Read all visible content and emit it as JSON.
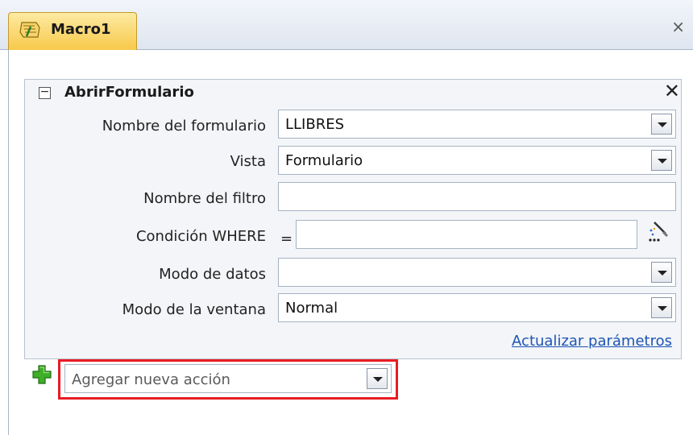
{
  "window": {
    "tab_title": "Macro1",
    "close_glyph": "×"
  },
  "action": {
    "name": "AbrirFormulario",
    "collapse_glyph": "−",
    "remove_glyph": "✕",
    "fields": {
      "form_name": {
        "label": "Nombre del formulario",
        "value": "LLIBRES"
      },
      "view": {
        "label": "Vista",
        "value": "Formulario"
      },
      "filter_name": {
        "label": "Nombre del filtro",
        "value": ""
      },
      "where": {
        "label": "Condición WHERE",
        "prefix": "=",
        "value": ""
      },
      "data_mode": {
        "label": "Modo de datos",
        "value": ""
      },
      "window_mode": {
        "label": "Modo de la ventana",
        "value": "Normal"
      }
    },
    "update_link": "Actualizar parámetros"
  },
  "add_action": {
    "placeholder": "Agregar nueva acción"
  },
  "icons": {
    "tab": "macro-icon",
    "plus": "add-icon",
    "builder": "expression-builder-icon"
  },
  "colors": {
    "highlight": "#e81c24",
    "link": "#1d55b3",
    "tab": "#f7c94a"
  }
}
